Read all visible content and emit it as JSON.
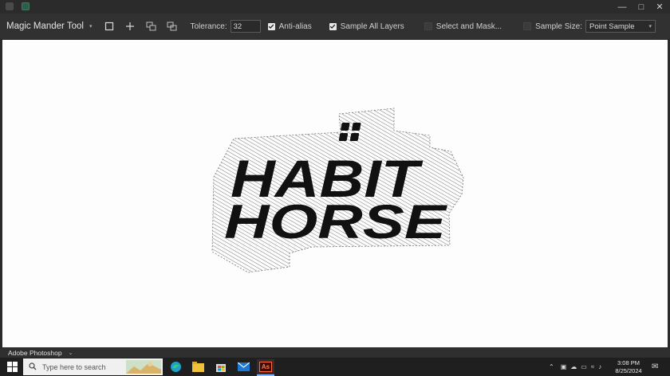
{
  "options_bar": {
    "tool_name": "Magic Mander Tool",
    "tolerance_label": "Tolerance:",
    "tolerance_value": "32",
    "anti_alias_label": "Anti-alias",
    "sample_all_layers_label": "Sample All Layers",
    "select_and_mask_label": "Select and Mask...",
    "sample_size_label": "Sample Size:",
    "sample_size_value": "Point Sample",
    "icons": [
      "new-selection-icon",
      "add-to-selection-icon",
      "subtract-from-selection-icon",
      "intersect-selection-icon"
    ],
    "checked": {
      "anti_alias": true,
      "sample_all_layers": true,
      "select_and_mask": false,
      "sample_size": false
    }
  },
  "canvas": {
    "logo_line1": "HABIT",
    "logo_line2": "HORSE"
  },
  "status_bar": {
    "app_name": "Adobe Photoshop"
  },
  "taskbar": {
    "search_placeholder": "Type here to search",
    "apps": [
      "edge-icon",
      "file-explorer-icon",
      "microsoft-store-icon",
      "mail-icon",
      "animate-app-icon"
    ],
    "animate_label": "As",
    "clock_time": "3:08 PM",
    "clock_date": "8/25/2024"
  },
  "colors": {
    "app_chrome": "#313131",
    "canvas_bg": "#fdfdfd",
    "taskbar": "#1f1f1f",
    "logo_ink": "#111111"
  }
}
